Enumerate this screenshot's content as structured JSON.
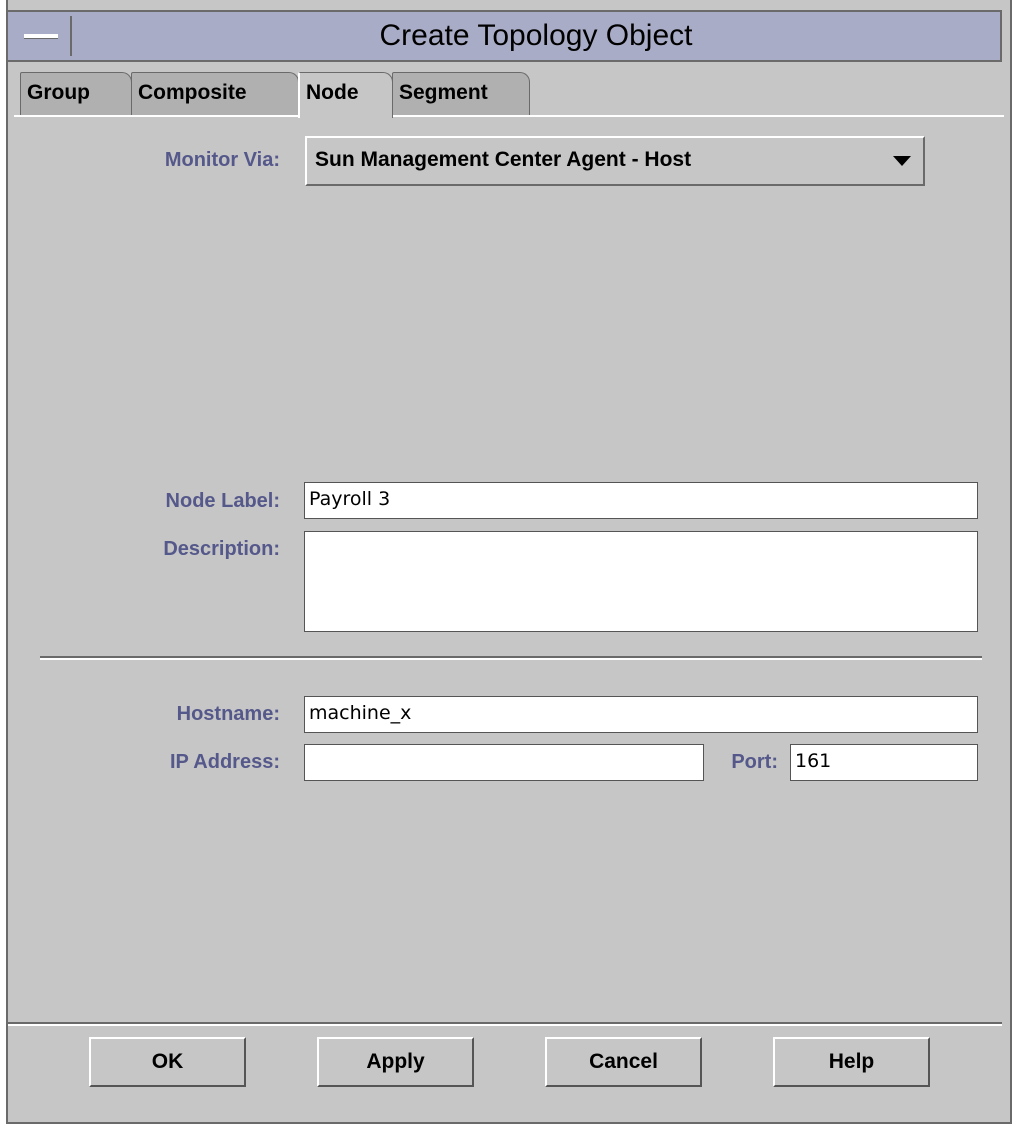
{
  "window": {
    "title": "Create Topology Object"
  },
  "tabs": [
    {
      "label": "Group",
      "active": false
    },
    {
      "label": "Composite",
      "active": false
    },
    {
      "label": "Node",
      "active": true
    },
    {
      "label": "Segment",
      "active": false
    }
  ],
  "form": {
    "monitor_via_label": "Monitor Via:",
    "monitor_via_value": "Sun Management Center Agent - Host",
    "node_label_label": "Node Label:",
    "node_label_value": "Payroll 3",
    "description_label": "Description:",
    "description_value": "",
    "hostname_label": "Hostname:",
    "hostname_value": "machine_x",
    "ip_address_label": "IP Address:",
    "ip_address_value": "",
    "port_label": "Port:",
    "port_value": "161"
  },
  "buttons": {
    "ok": "OK",
    "apply": "Apply",
    "cancel": "Cancel",
    "help": "Help"
  },
  "colors": {
    "window_bg": "#c6c6c6",
    "titlebar_bg": "#a8acc6",
    "label_text": "#55588a"
  },
  "icons": {
    "window_menu": "window-menu-icon",
    "dropdown_arrow": "dropdown-arrow-icon"
  }
}
